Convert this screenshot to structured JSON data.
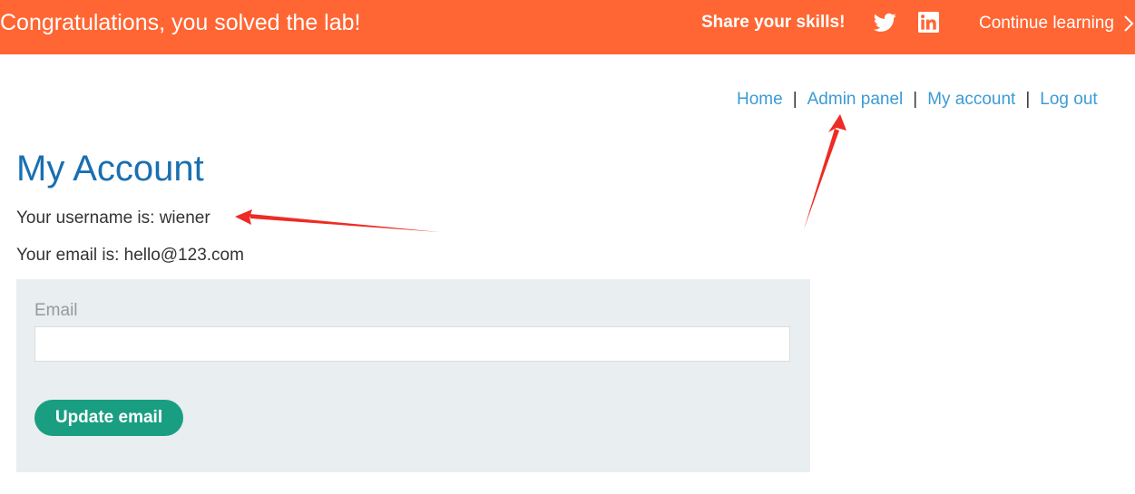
{
  "banner": {
    "message": "Congratulations, you solved the lab!",
    "share_label": "Share your skills!",
    "twitter_icon": "twitter-icon",
    "linkedin_icon": "linkedin-icon",
    "continue_label": "Continue learning",
    "continue_icon": "chevron-right-icon",
    "background_color": "#ff6633"
  },
  "nav": {
    "items": [
      {
        "label": "Home"
      },
      {
        "label": "Admin panel"
      },
      {
        "label": "My account"
      },
      {
        "label": "Log out"
      }
    ],
    "separator": "|",
    "link_color": "#3b9bd4"
  },
  "page": {
    "title": "My Account",
    "username_line": "Your username is: wiener",
    "email_line": "Your email is: hello@123.com"
  },
  "form": {
    "email_label": "Email",
    "email_value": "",
    "submit_label": "Update email",
    "button_color": "#1a9e82"
  },
  "annotations": {
    "color": "#ee2b24"
  }
}
